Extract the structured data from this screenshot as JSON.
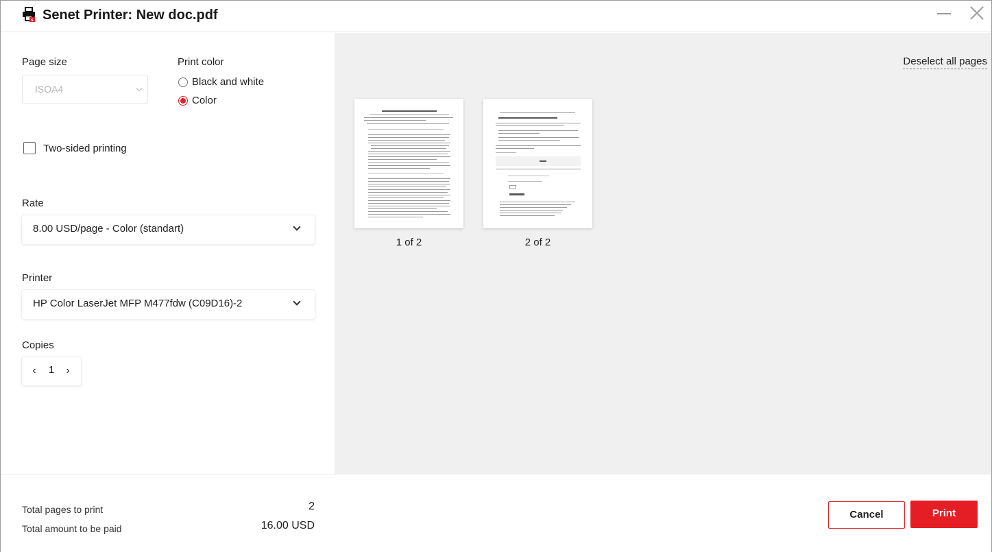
{
  "window": {
    "title": "Senet Printer: New doc.pdf"
  },
  "settings": {
    "page_size_label": "Page size",
    "page_size_value": "ISOA4",
    "print_color_label": "Print color",
    "color_options": [
      {
        "label": "Black and white",
        "selected": false
      },
      {
        "label": "Color",
        "selected": true
      }
    ],
    "two_sided_label": "Two-sided printing",
    "two_sided_checked": false,
    "rate_label": "Rate",
    "rate_value": "8.00 USD/page - Color (standart)",
    "printer_label": "Printer",
    "printer_value": "HP Color LaserJet MFP M477fdw (C09D16)-2",
    "copies_label": "Copies",
    "copies_value": "1",
    "copies_decrement": "‹",
    "copies_increment": "›"
  },
  "preview": {
    "deselect_label": "Deselect all pages",
    "pages": [
      {
        "label": "1 of 2"
      },
      {
        "label": "2 of 2"
      }
    ]
  },
  "footer": {
    "total_pages_label": "Total pages to print",
    "total_pages_value": "2",
    "total_amount_label": "Total amount to be paid",
    "total_amount_value": "16.00 USD",
    "cancel_label": "Cancel",
    "print_label": "Print"
  },
  "colors": {
    "accent": "#e51e26",
    "preview_bg": "#f0f0f0"
  },
  "icons": {
    "title_icon": "printer-icon",
    "minimize": "minimize-icon",
    "close": "close-icon"
  }
}
